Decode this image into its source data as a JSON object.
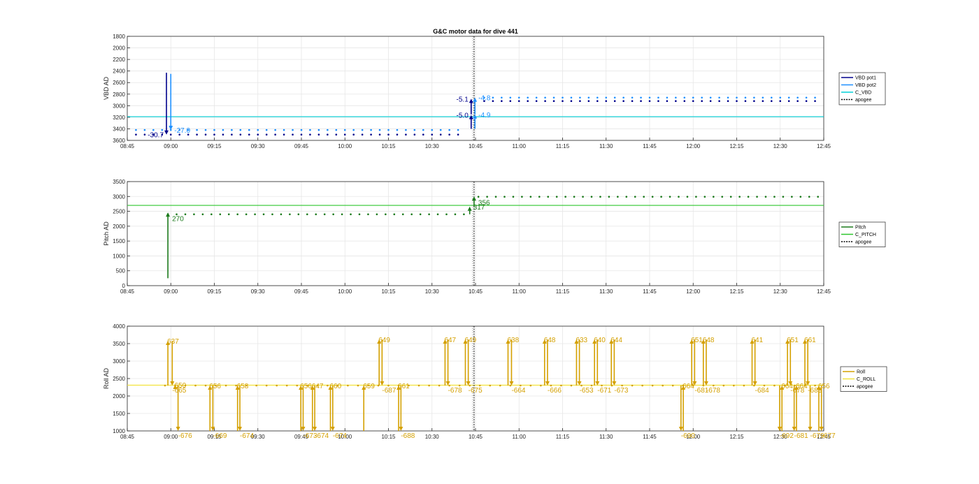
{
  "figure": {
    "title": "G&C motor data for dive 441"
  },
  "chart_data": [
    {
      "type": "line",
      "name": "vbd",
      "title": "G&C motor data for dive 441",
      "xlabel": "",
      "ylabel": "VBD AD",
      "x_ticks": [
        "08:45",
        "09:00",
        "09:15",
        "09:30",
        "09:45",
        "10:00",
        "10:15",
        "10:30",
        "10:45",
        "11:00",
        "11:15",
        "11:30",
        "11:45",
        "12:00",
        "12:15",
        "12:30",
        "12:45"
      ],
      "xlim_minutes": [
        0,
        240
      ],
      "y_ticks": [
        1800,
        2000,
        2200,
        2400,
        2600,
        2800,
        3000,
        3200,
        3400,
        3600
      ],
      "ylim": [
        1800,
        3600
      ],
      "y_reversed": true,
      "grid": true,
      "legend": {
        "position": "outside-right",
        "entries": [
          "VBD pot1",
          "VBD pot2",
          "C_VBD",
          "apogee"
        ]
      },
      "colors": {
        "pot1": "#00008b",
        "pot2": "#1e90ff",
        "c": "#00d0d8",
        "apogee": "#000000"
      },
      "apogee_min": 119.5,
      "reference_line": {
        "name": "C_VBD",
        "value": 3190
      },
      "series": [
        {
          "name": "VBD pot1",
          "dots": {
            "x_start": 3,
            "x_end": 115,
            "step": 3,
            "y": 3500
          }
        },
        {
          "name": "VBD pot1",
          "dots": {
            "x_start": 123,
            "x_end": 239,
            "step": 3,
            "y": 2920
          }
        },
        {
          "name": "VBD pot2",
          "dots": {
            "x_start": 3,
            "x_end": 115,
            "step": 3,
            "y": 3420
          }
        },
        {
          "name": "VBD pot2",
          "dots": {
            "x_start": 123,
            "x_end": 239,
            "step": 3,
            "y": 2860
          }
        }
      ],
      "arrows": [
        {
          "x": 13.5,
          "from": 2430,
          "to": 3500,
          "label": "-30.7",
          "color": "#00008b",
          "label_side": "left"
        },
        {
          "x": 15,
          "from": 2450,
          "to": 3420,
          "label": "-27.0",
          "color": "#1e90ff",
          "label_side": "right"
        },
        {
          "x": 118.5,
          "from": 3400,
          "to": 3160,
          "label": "-5.0",
          "color": "#00008b",
          "label_side": "left"
        },
        {
          "x": 119.8,
          "from": 3400,
          "to": 3150,
          "label": "-4.9",
          "color": "#1e90ff",
          "label_side": "right"
        },
        {
          "x": 118.5,
          "from": 3150,
          "to": 2880,
          "label": "-5.1",
          "color": "#00008b",
          "label_side": "left"
        },
        {
          "x": 119.8,
          "from": 3150,
          "to": 2860,
          "label": "-4.8",
          "color": "#1e90ff",
          "label_side": "right"
        }
      ]
    },
    {
      "type": "line",
      "name": "pitch",
      "title": "",
      "xlabel": "",
      "ylabel": "Pitch AD",
      "x_ticks": [
        "08:45",
        "09:00",
        "09:15",
        "09:30",
        "09:45",
        "10:00",
        "10:15",
        "10:30",
        "10:45",
        "11:00",
        "11:15",
        "11:30",
        "11:45",
        "12:00",
        "12:15",
        "12:30",
        "12:45"
      ],
      "xlim_minutes": [
        0,
        240
      ],
      "y_ticks": [
        0,
        500,
        1000,
        1500,
        2000,
        2500,
        3000,
        3500
      ],
      "ylim": [
        0,
        3500
      ],
      "y_reversed": false,
      "grid": true,
      "legend": {
        "position": "outside-right",
        "entries": [
          "Pitch",
          "C_PITCH",
          "apogee"
        ]
      },
      "colors": {
        "pitch": "#1b7a1b",
        "c": "#2ec62e",
        "apogee": "#000000"
      },
      "apogee_min": 119.5,
      "reference_line": {
        "name": "C_PITCH",
        "value": 2700
      },
      "series": [
        {
          "name": "Pitch",
          "dots": {
            "x_start": 14,
            "x_end": 118,
            "step": 3,
            "y": 2400
          }
        },
        {
          "name": "Pitch",
          "dots": {
            "x_start": 121,
            "x_end": 239,
            "step": 3,
            "y": 2990
          }
        }
      ],
      "arrows": [
        {
          "x": 14,
          "from": 250,
          "to": 2460,
          "label": "270",
          "color": "#1b7a1b",
          "label_side": "right-below"
        },
        {
          "x": 118,
          "from": 2400,
          "to": 2660,
          "label": "317",
          "color": "#1b7a1b",
          "label_side": "right"
        },
        {
          "x": 119.5,
          "from": 2660,
          "to": 3000,
          "label": "356",
          "color": "#1b7a1b",
          "label_side": "right-below"
        }
      ]
    },
    {
      "type": "line",
      "name": "roll",
      "title": "",
      "xlabel": "",
      "ylabel": "Roll AD",
      "x_ticks": [
        "08:45",
        "09:00",
        "09:15",
        "09:30",
        "09:45",
        "10:00",
        "10:15",
        "10:30",
        "10:45",
        "11:00",
        "11:15",
        "11:30",
        "11:45",
        "12:00",
        "12:15",
        "12:30",
        "12:45"
      ],
      "xlim_minutes": [
        0,
        240
      ],
      "y_ticks": [
        1000,
        1500,
        2000,
        2500,
        3000,
        3500,
        4000
      ],
      "ylim": [
        1000,
        4000
      ],
      "y_reversed": false,
      "grid": true,
      "legend": {
        "position": "outside-right",
        "entries": [
          "Roll",
          "C_ROLL",
          "apogee"
        ]
      },
      "colors": {
        "roll": "#d4a000",
        "c": "#f2e23c",
        "apogee": "#000000"
      },
      "apogee_min": 119.5,
      "reference_line": {
        "name": "C_ROLL",
        "value": 2310
      },
      "series": [
        {
          "name": "Roll",
          "dots": {
            "x_start": 13,
            "x_end": 238,
            "step": 3.5,
            "y": 2300
          }
        }
      ],
      "arrows": [
        {
          "x": 14,
          "from": 2300,
          "to": 3580,
          "label": "637",
          "color": "#d4a000",
          "label_side": "top"
        },
        {
          "x": 15.5,
          "from": 3580,
          "to": 2300,
          "label": "-665",
          "color": "#d4a000",
          "label_side": "below"
        },
        {
          "x": 16.5,
          "from": 2300,
          "to": 2320,
          "label": "650",
          "color": "#d4a000",
          "label_side": "top"
        },
        {
          "x": 17.5,
          "from": 2300,
          "to": 1000,
          "label": "-676",
          "color": "#d4a000",
          "label_side": "below"
        },
        {
          "x": 28.5,
          "from": 1000,
          "to": 2300,
          "label": "656",
          "color": "#d4a000",
          "label_side": "top"
        },
        {
          "x": 29.5,
          "from": 2300,
          "to": 1000,
          "label": "-669",
          "color": "#d4a000",
          "label_side": "below"
        },
        {
          "x": 38,
          "from": 1000,
          "to": 2300,
          "label": "658",
          "color": "#d4a000",
          "label_side": "top"
        },
        {
          "x": 38.8,
          "from": 2300,
          "to": 1000,
          "label": "-674",
          "color": "#d4a000",
          "label_side": "below"
        },
        {
          "x": 59.8,
          "from": 1000,
          "to": 2300,
          "label": "656",
          "color": "#d4a000",
          "label_side": "top"
        },
        {
          "x": 60.6,
          "from": 2300,
          "to": 1000,
          "label": "-673",
          "color": "#d4a000",
          "label_side": "below"
        },
        {
          "x": 63.8,
          "from": 1000,
          "to": 2300,
          "label": "647",
          "color": "#d4a000",
          "label_side": "top"
        },
        {
          "x": 64.6,
          "from": 2300,
          "to": 1000,
          "label": "-674",
          "color": "#d4a000",
          "label_side": "below"
        },
        {
          "x": 70,
          "from": 1000,
          "to": 2300,
          "label": "660",
          "color": "#d4a000",
          "label_side": "top"
        },
        {
          "x": 70.8,
          "from": 2300,
          "to": 1000,
          "label": "-674",
          "color": "#d4a000",
          "label_side": "below"
        },
        {
          "x": 81.5,
          "from": 1000,
          "to": 2300,
          "label": "659",
          "color": "#d4a000",
          "label_side": "top"
        },
        {
          "x": 86.8,
          "from": 2300,
          "to": 3620,
          "label": "649",
          "color": "#d4a000",
          "label_side": "top"
        },
        {
          "x": 87.8,
          "from": 3620,
          "to": 2300,
          "label": "-687",
          "color": "#d4a000",
          "label_side": "below"
        },
        {
          "x": 93.5,
          "from": 1000,
          "to": 2300,
          "label": "661",
          "color": "#d4a000",
          "label_side": "top"
        },
        {
          "x": 94.3,
          "from": 2300,
          "to": 1000,
          "label": "-688",
          "color": "#d4a000",
          "label_side": "below"
        },
        {
          "x": 109.5,
          "from": 2300,
          "to": 3620,
          "label": "647",
          "color": "#d4a000",
          "label_side": "top"
        },
        {
          "x": 110.5,
          "from": 3620,
          "to": 2300,
          "label": "-678",
          "color": "#d4a000",
          "label_side": "below"
        },
        {
          "x": 116.5,
          "from": 2300,
          "to": 3620,
          "label": "649",
          "color": "#d4a000",
          "label_side": "top"
        },
        {
          "x": 117.5,
          "from": 3620,
          "to": 2300,
          "label": "-675",
          "color": "#d4a000",
          "label_side": "below"
        },
        {
          "x": 131.2,
          "from": 2300,
          "to": 3620,
          "label": "638",
          "color": "#d4a000",
          "label_side": "top"
        },
        {
          "x": 132.4,
          "from": 3620,
          "to": 2300,
          "label": "-664",
          "color": "#d4a000",
          "label_side": "below"
        },
        {
          "x": 143.8,
          "from": 2300,
          "to": 3620,
          "label": "648",
          "color": "#d4a000",
          "label_side": "top"
        },
        {
          "x": 144.8,
          "from": 3620,
          "to": 2300,
          "label": "-666",
          "color": "#d4a000",
          "label_side": "below"
        },
        {
          "x": 154.8,
          "from": 2300,
          "to": 3620,
          "label": "633",
          "color": "#d4a000",
          "label_side": "top"
        },
        {
          "x": 155.8,
          "from": 3620,
          "to": 2300,
          "label": "-653",
          "color": "#d4a000",
          "label_side": "below"
        },
        {
          "x": 161,
          "from": 2300,
          "to": 3620,
          "label": "640",
          "color": "#d4a000",
          "label_side": "top"
        },
        {
          "x": 162,
          "from": 3620,
          "to": 2300,
          "label": "-671",
          "color": "#d4a000",
          "label_side": "below"
        },
        {
          "x": 166.8,
          "from": 2300,
          "to": 3620,
          "label": "644",
          "color": "#d4a000",
          "label_side": "top"
        },
        {
          "x": 167.8,
          "from": 3620,
          "to": 2300,
          "label": "-673",
          "color": "#d4a000",
          "label_side": "below"
        },
        {
          "x": 190.8,
          "from": 2300,
          "to": 1000,
          "label": "-690",
          "color": "#d4a000",
          "label_side": "below"
        },
        {
          "x": 191.6,
          "from": 1000,
          "to": 2300,
          "label": "664",
          "color": "#d4a000",
          "label_side": "top"
        },
        {
          "x": 194.5,
          "from": 2300,
          "to": 3620,
          "label": "651",
          "color": "#d4a000",
          "label_side": "top"
        },
        {
          "x": 195.5,
          "from": 3620,
          "to": 2300,
          "label": "-681",
          "color": "#d4a000",
          "label_side": "below"
        },
        {
          "x": 198.5,
          "from": 2300,
          "to": 3620,
          "label": "648",
          "color": "#d4a000",
          "label_side": "top"
        },
        {
          "x": 199.5,
          "from": 3620,
          "to": 2300,
          "label": "-678",
          "color": "#d4a000",
          "label_side": "below"
        },
        {
          "x": 215.3,
          "from": 2300,
          "to": 3620,
          "label": "641",
          "color": "#d4a000",
          "label_side": "top"
        },
        {
          "x": 216.3,
          "from": 3620,
          "to": 2300,
          "label": "-684",
          "color": "#d4a000",
          "label_side": "below"
        },
        {
          "x": 224.8,
          "from": 2300,
          "to": 1000,
          "label": "-692",
          "color": "#d4a000",
          "label_side": "below"
        },
        {
          "x": 225.6,
          "from": 1000,
          "to": 2300,
          "label": "664",
          "color": "#d4a000",
          "label_side": "top"
        },
        {
          "x": 227.5,
          "from": 2300,
          "to": 3620,
          "label": "651",
          "color": "#d4a000",
          "label_side": "top"
        },
        {
          "x": 228.5,
          "from": 3620,
          "to": 2300,
          "label": "-678",
          "color": "#d4a000",
          "label_side": "below"
        },
        {
          "x": 229.8,
          "from": 2300,
          "to": 1000,
          "label": "-681",
          "color": "#d4a000",
          "label_side": "below"
        },
        {
          "x": 230.6,
          "from": 1000,
          "to": 2300,
          "label": "664",
          "color": "#d4a000",
          "label_side": "top"
        },
        {
          "x": 233.5,
          "from": 2300,
          "to": 3620,
          "label": "661",
          "color": "#d4a000",
          "label_side": "top"
        },
        {
          "x": 234.5,
          "from": 3620,
          "to": 2300,
          "label": "-683",
          "color": "#d4a000",
          "label_side": "below"
        },
        {
          "x": 235.3,
          "from": 2300,
          "to": 1000,
          "label": "-679",
          "color": "#d4a000",
          "label_side": "below"
        },
        {
          "x": 238.3,
          "from": 1000,
          "to": 2300,
          "label": "656",
          "color": "#d4a000",
          "label_side": "top"
        },
        {
          "x": 239.2,
          "from": 2300,
          "to": 1000,
          "label": "-677",
          "color": "#d4a000",
          "label_side": "below"
        }
      ]
    }
  ]
}
